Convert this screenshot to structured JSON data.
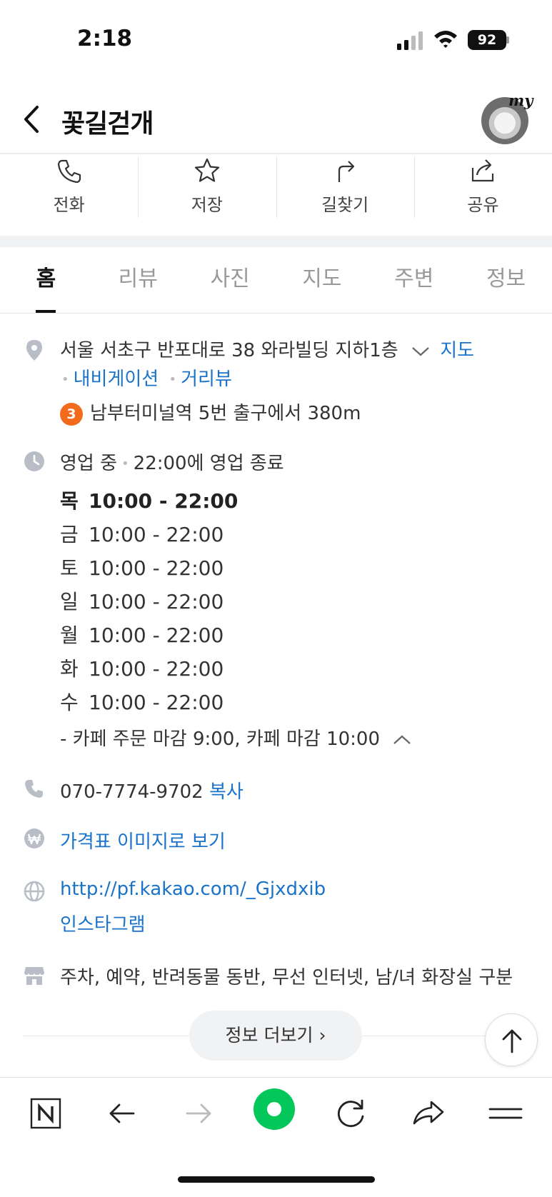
{
  "status_bar": {
    "time": "2:18",
    "battery": "92"
  },
  "header": {
    "title": "꽃길걷개",
    "avatar_label": "my"
  },
  "actions": [
    {
      "label": "전화",
      "icon": "phone-icon"
    },
    {
      "label": "저장",
      "icon": "star-icon"
    },
    {
      "label": "길찾기",
      "icon": "directions-icon"
    },
    {
      "label": "공유",
      "icon": "share-icon"
    }
  ],
  "tabs": [
    "홈",
    "리뷰",
    "사진",
    "지도",
    "주변",
    "정보"
  ],
  "address": {
    "text": "서울 서초구 반포대로 38 와라빌딩 지하1층",
    "map_link": "지도",
    "nav_link": "내비게이션",
    "street_link": "거리뷰",
    "subway_line": "3",
    "subway_text": "남부터미널역 5번 출구에서 380m"
  },
  "hours": {
    "status": "영업 중",
    "close_info": "22:00에 영업 종료",
    "days": [
      {
        "day": "목",
        "time": "10:00 - 22:00"
      },
      {
        "day": "금",
        "time": "10:00 - 22:00"
      },
      {
        "day": "토",
        "time": "10:00 - 22:00"
      },
      {
        "day": "일",
        "time": "10:00 - 22:00"
      },
      {
        "day": "월",
        "time": "10:00 - 22:00"
      },
      {
        "day": "화",
        "time": "10:00 - 22:00"
      },
      {
        "day": "수",
        "time": "10:00 - 22:00"
      }
    ],
    "note": "- 카페 주문 마감 9:00, 카페 마감 10:00"
  },
  "phone": {
    "number": "070-7774-9702",
    "copy_label": "복사"
  },
  "price": {
    "label": "가격표 이미지로 보기"
  },
  "web": {
    "url": "http://pf.kakao.com/_Gjxdxib",
    "instagram": "인스타그램"
  },
  "amenities": {
    "text": "주차, 예약, 반려동물 동반, 무선 인터넷, 남/녀 화장실 구분"
  },
  "more_button": "정보 더보기 ›",
  "colors": {
    "link": "#1a73c9",
    "naver_green": "#03c75a",
    "subway_line3": "#f26b1d"
  }
}
